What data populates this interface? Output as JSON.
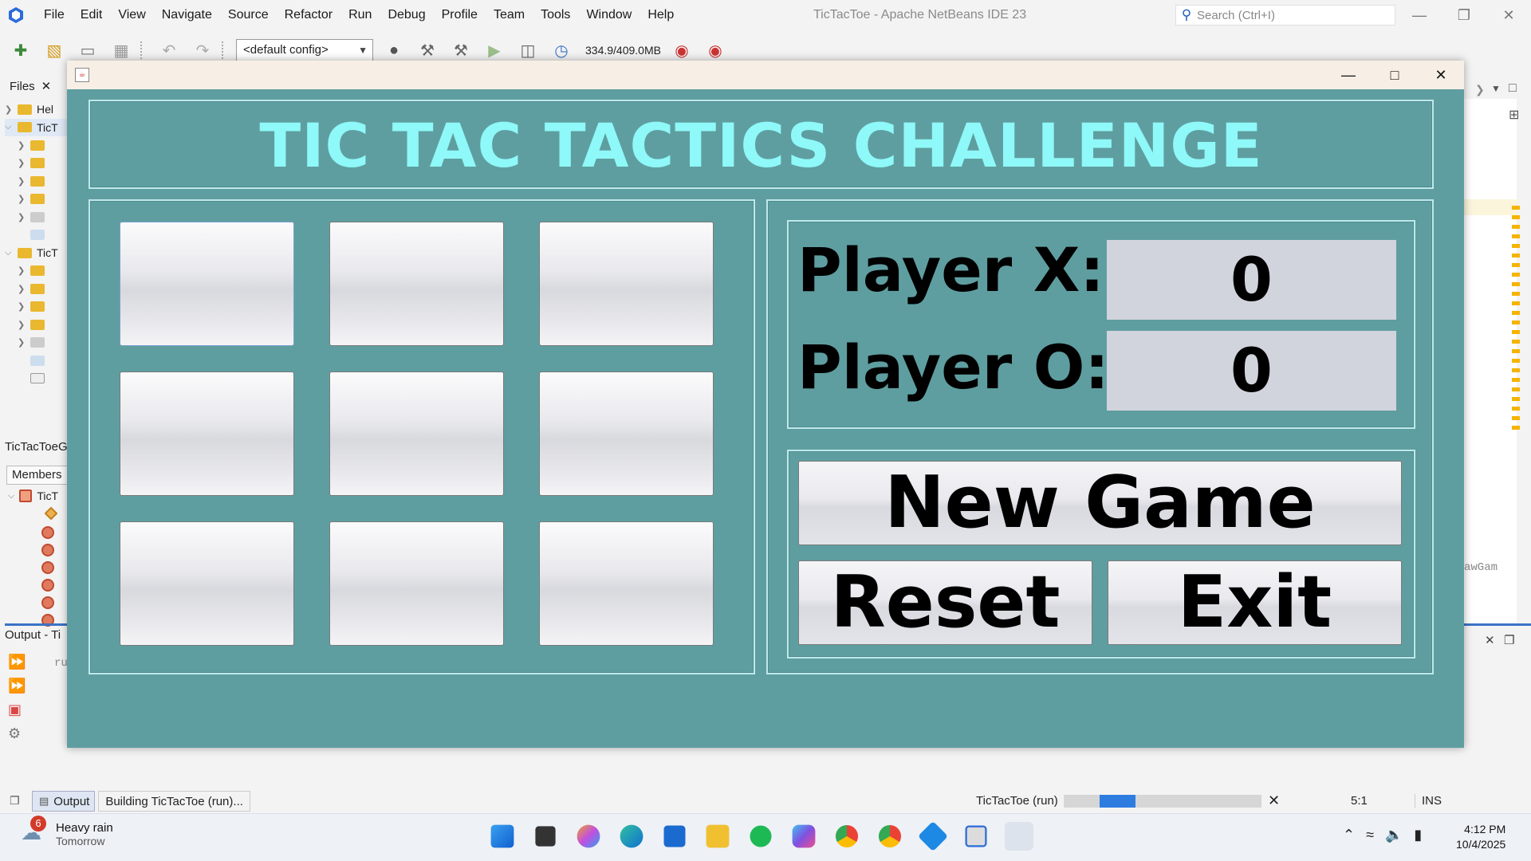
{
  "ide": {
    "menu": [
      "File",
      "Edit",
      "View",
      "Navigate",
      "Source",
      "Refactor",
      "Run",
      "Debug",
      "Profile",
      "Team",
      "Tools",
      "Window",
      "Help"
    ],
    "title": "TicTacToe - Apache NetBeans IDE 23",
    "search_placeholder": "Search (Ctrl+I)",
    "config": "<default config>",
    "memory": "334.9/409.0MB",
    "files_tab": "Files",
    "tree": [
      "Hel",
      "TicT",
      "",
      "",
      "",
      "",
      "",
      "",
      "TicT",
      "",
      "",
      "",
      "",
      "",
      "",
      ""
    ],
    "navigator_title": "TicTacToeG",
    "members_tab": "Members",
    "members_root": "TicT",
    "output_title": "Output - Ti",
    "output_line": "ru",
    "right_code": "awGam",
    "status": {
      "output_tab": "Output",
      "building": "Building TicTacToe (run)...",
      "run": "TicTacToe (run)",
      "progress": 0.2,
      "position": "5:1",
      "mode": "INS"
    }
  },
  "taskbar": {
    "weather_badge": "6",
    "weather_title": "Heavy rain",
    "weather_sub": "Tomorrow",
    "time": "4:12 PM",
    "date": "10/4/2025"
  },
  "game": {
    "title": "TIC TAC TACTICS CHALLENGE",
    "board": [
      "",
      "",
      "",
      "",
      "",
      "",
      "",
      "",
      ""
    ],
    "player_x_label": "Player X:",
    "player_o_label": "Player O:",
    "player_x_score": "0",
    "player_o_score": "0",
    "new_game": "New Game",
    "reset": "Reset",
    "exit": "Exit",
    "colors": {
      "background": "#5f9ea0",
      "title": "#8ff8f8"
    }
  }
}
